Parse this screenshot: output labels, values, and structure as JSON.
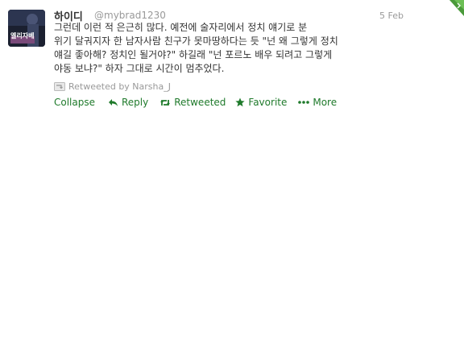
{
  "tweet": {
    "author_name": "하이디",
    "handle": "@mybrad1230",
    "date": "5 Feb",
    "avatar_text": "엘리자베",
    "lines": [
      "그런데 이런 적 은근히 많다. 예전에 술자리에서 정치 얘기로 분",
      "위기 달궈지자 한 남자사람 친구가 못마땅하다는 듯 \"넌 왜 그렇게 정치",
      "얘길 좋아해? 정치인 될거야?\" 하길래 \"넌 포르노 배우 되려고 그렇게",
      "야동 보냐?\" 하자 그대로 시간이 멈추었다."
    ],
    "retweeted_by": "Retweeted by Narsha_J"
  },
  "actions": {
    "collapse": "Collapse",
    "reply": "Reply",
    "retweeted": "Retweeted",
    "favorite": "Favorite",
    "more": "More"
  },
  "colors": {
    "action_green": "#1f7a2b",
    "muted_gray": "#999999",
    "text": "#333333"
  },
  "icons": {
    "reply": "reply-arrow-icon",
    "retweet": "retweet-icon",
    "favorite": "star-icon",
    "more": "ellipsis-icon",
    "corner": "retweet-corner-badge-icon"
  }
}
